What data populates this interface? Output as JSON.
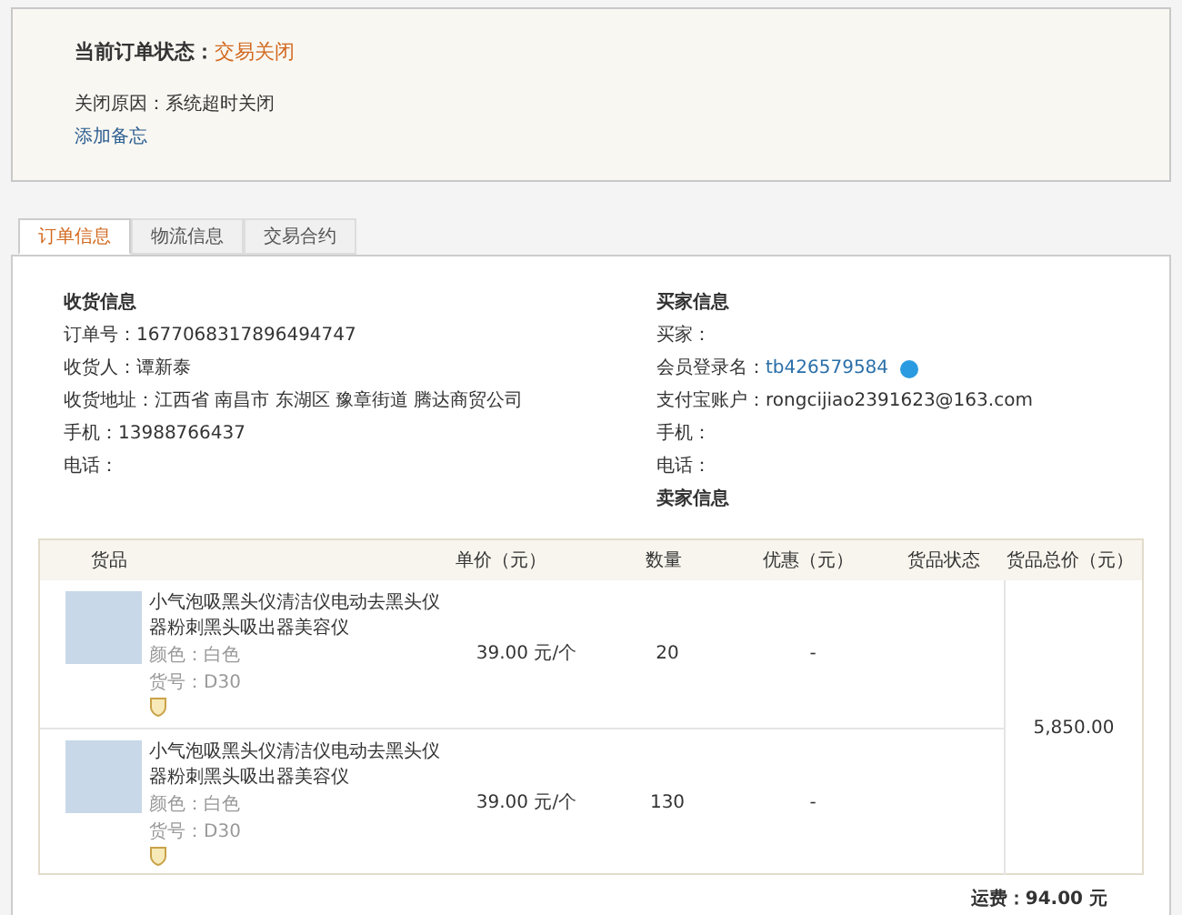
{
  "status": {
    "label": "当前订单状态：",
    "value": "交易关闭",
    "reason": "关闭原因：系统超时关闭",
    "add_note": "添加备忘"
  },
  "tabs": [
    {
      "label": "订单信息",
      "selected": true
    },
    {
      "label": "物流信息",
      "selected": false
    },
    {
      "label": "交易合约",
      "selected": false
    }
  ],
  "receiver": {
    "title": "收货信息",
    "lines": [
      "订单号：1677068317896494747",
      "收货人：谭新泰",
      "收货地址：江西省 南昌市 东湖区 豫章街道 腾达商贸公司",
      "手机：13988766437",
      "电话："
    ]
  },
  "buyer": {
    "title": "买家信息",
    "lines": [
      {
        "label": "买家："
      },
      {
        "label": "会员登录名：",
        "link": "tb426579584"
      },
      {
        "label": "支付宝账户：",
        "value": "rongcijiao2391623@163.com"
      },
      {
        "label": "手机："
      },
      {
        "label": "电话："
      }
    ]
  },
  "seller": {
    "title": "卖家信息"
  },
  "table": {
    "columns": [
      "货品",
      "单价（元）",
      "数量",
      "优惠（元）",
      "货品状态",
      "货品总价（元）"
    ],
    "rows": [
      {
        "title": "小气泡吸黑头仪清洁仪电动去黑头仪器粉刺黑头吸出器美容仪",
        "variant": "颜色：白色",
        "sku": "货号：D30",
        "price": "39.00 元/个",
        "qty": "20",
        "discount": "-"
      },
      {
        "title": "小气泡吸黑头仪清洁仪电动去黑头仪器粉刺黑头吸出器美容仪",
        "variant": "颜色：白色",
        "sku": "货号：D30",
        "price": "39.00 元/个",
        "qty": "130",
        "discount": "-"
      }
    ],
    "total": "5,850.00",
    "freight": "运费：94.00 元"
  }
}
